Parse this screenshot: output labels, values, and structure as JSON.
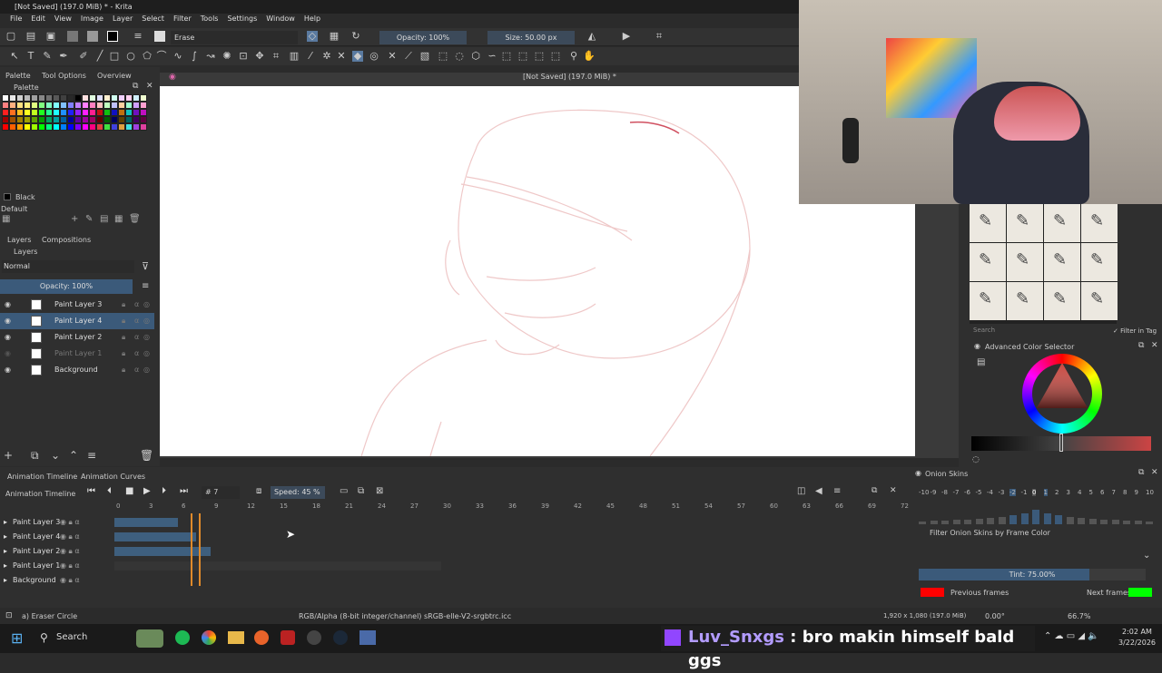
{
  "window": {
    "title": "[Not Saved] (197.0 MiB) * - Krita"
  },
  "menu": [
    "File",
    "Edit",
    "View",
    "Image",
    "Layer",
    "Select",
    "Filter",
    "Tools",
    "Settings",
    "Window",
    "Help"
  ],
  "toolbar": {
    "preset_name": "Erase",
    "opacity": "Opacity: 100%",
    "size": "Size: 50.00 px"
  },
  "canvas": {
    "header": "[Not Saved]  (197.0 MiB) *"
  },
  "left_dock": {
    "tabs": [
      "Palette",
      "Tool Options",
      "Overview"
    ],
    "palette_header": "Palette",
    "color_name": "Black",
    "palette_name": "Default",
    "swatches": [
      "#ffffff",
      "#e8e8e8",
      "#d0d0d0",
      "#b8b8b8",
      "#a0a0a0",
      "#888",
      "#707070",
      "#585858",
      "#404040",
      "#282828",
      "#000",
      "#ffe0e0",
      "#e0ffe0",
      "#e0e0ff",
      "#fff0d0",
      "#d0fff0",
      "#f0d0ff",
      "#ffd0f0",
      "#d0f0ff",
      "#f0ffd0",
      "#ff8080",
      "#ffb080",
      "#ffe080",
      "#fff080",
      "#e0ff80",
      "#80ff80",
      "#80ffc0",
      "#80ffff",
      "#80c0ff",
      "#8080ff",
      "#c080ff",
      "#ff80ff",
      "#ff80c0",
      "#ffc0c0",
      "#c0ffc0",
      "#c0c0ff",
      "#ffd0a0",
      "#a0ffd0",
      "#d0a0ff",
      "#ffa0d0",
      "#ff2020",
      "#ff7020",
      "#ffc020",
      "#ffff20",
      "#c0ff20",
      "#20ff20",
      "#20ff90",
      "#20ffff",
      "#2090ff",
      "#2020ff",
      "#9020ff",
      "#ff20ff",
      "#ff2090",
      "#c01010",
      "#10c010",
      "#1010c0",
      "#c07010",
      "#10c0c0",
      "#7010c0",
      "#c010c0",
      "#a00000",
      "#a05000",
      "#a08000",
      "#a0a000",
      "#60a000",
      "#00a000",
      "#00a060",
      "#00a0a0",
      "#0060a0",
      "#0000a0",
      "#6000a0",
      "#a000a0",
      "#a00060",
      "#600000",
      "#006000",
      "#000060",
      "#604000",
      "#006060",
      "#400060",
      "#600040",
      "#ff0000",
      "#ff6000",
      "#ffa000",
      "#ffff00",
      "#a0ff00",
      "#00ff00",
      "#00ff80",
      "#00ffff",
      "#0080ff",
      "#0000ff",
      "#8000ff",
      "#ff00ff",
      "#ff0080",
      "#e04040",
      "#40e040",
      "#4040e0",
      "#e0a040",
      "#40e0e0",
      "#a040e0",
      "#e040a0"
    ],
    "layers_tabs": [
      "Layers",
      "Compositions"
    ],
    "blend_mode": "Normal",
    "opacity": "Opacity:  100%",
    "layers": [
      {
        "name": "Paint Layer 3",
        "selected": false,
        "faded": false
      },
      {
        "name": "Paint Layer 4",
        "selected": true,
        "faded": false
      },
      {
        "name": "Paint Layer 2",
        "selected": false,
        "faded": false
      },
      {
        "name": "Paint Layer 1",
        "selected": false,
        "faded": true
      },
      {
        "name": "Background",
        "selected": false,
        "faded": false
      }
    ]
  },
  "animation": {
    "tabs": [
      "Animation Timeline",
      "Animation Curves"
    ],
    "title": "Animation Timeline",
    "frame": "# 7",
    "speed": "Speed: 45 %",
    "ruler": [
      "0",
      "3",
      "6",
      "9",
      "12",
      "15",
      "18",
      "21",
      "24",
      "27",
      "30",
      "33",
      "36",
      "39",
      "42",
      "45",
      "48",
      "51",
      "54",
      "57",
      "60",
      "63",
      "66",
      "69",
      "72"
    ],
    "layers": [
      "Paint Layer 3",
      "Paint Layer 4",
      "Paint Layer 2",
      "Paint Layer 1",
      "Background"
    ]
  },
  "onion": {
    "title": "Onion Skins",
    "numbers": [
      "-10",
      "-9",
      "-8",
      "-7",
      "-6",
      "-5",
      "-4",
      "-3",
      "-2",
      "-1",
      "0",
      "1",
      "2",
      "3",
      "4",
      "5",
      "6",
      "7",
      "8",
      "9",
      "10"
    ],
    "filter_label": "Filter Onion Skins by Frame Color",
    "tint": "Tint: 75.00%",
    "tint_level": 0.75,
    "previous": "Previous frames",
    "next": "Next frames",
    "prev_color": "#ff0000",
    "next_color": "#00ff00"
  },
  "right_dock": {
    "search_placeholder": "Search",
    "filter_in_tag": "Filter in Tag",
    "color_selector_title": "Advanced Color Selector"
  },
  "status": {
    "tool": "a) Eraser Circle",
    "colorspace": "RGB/Alpha (8-bit integer/channel)  sRGB-elle-V2-srgbtrc.icc",
    "dims": "1,920 x 1,080 (197.0 MiB)",
    "rotation": "0.00°",
    "zoom": "66.7%"
  },
  "taskbar": {
    "search": "Search",
    "time": "2:02 AM",
    "date": "3/22/2026"
  },
  "chat": {
    "user": "Luv_Snxgs",
    "message": " : bro makin himself bald ggs"
  }
}
